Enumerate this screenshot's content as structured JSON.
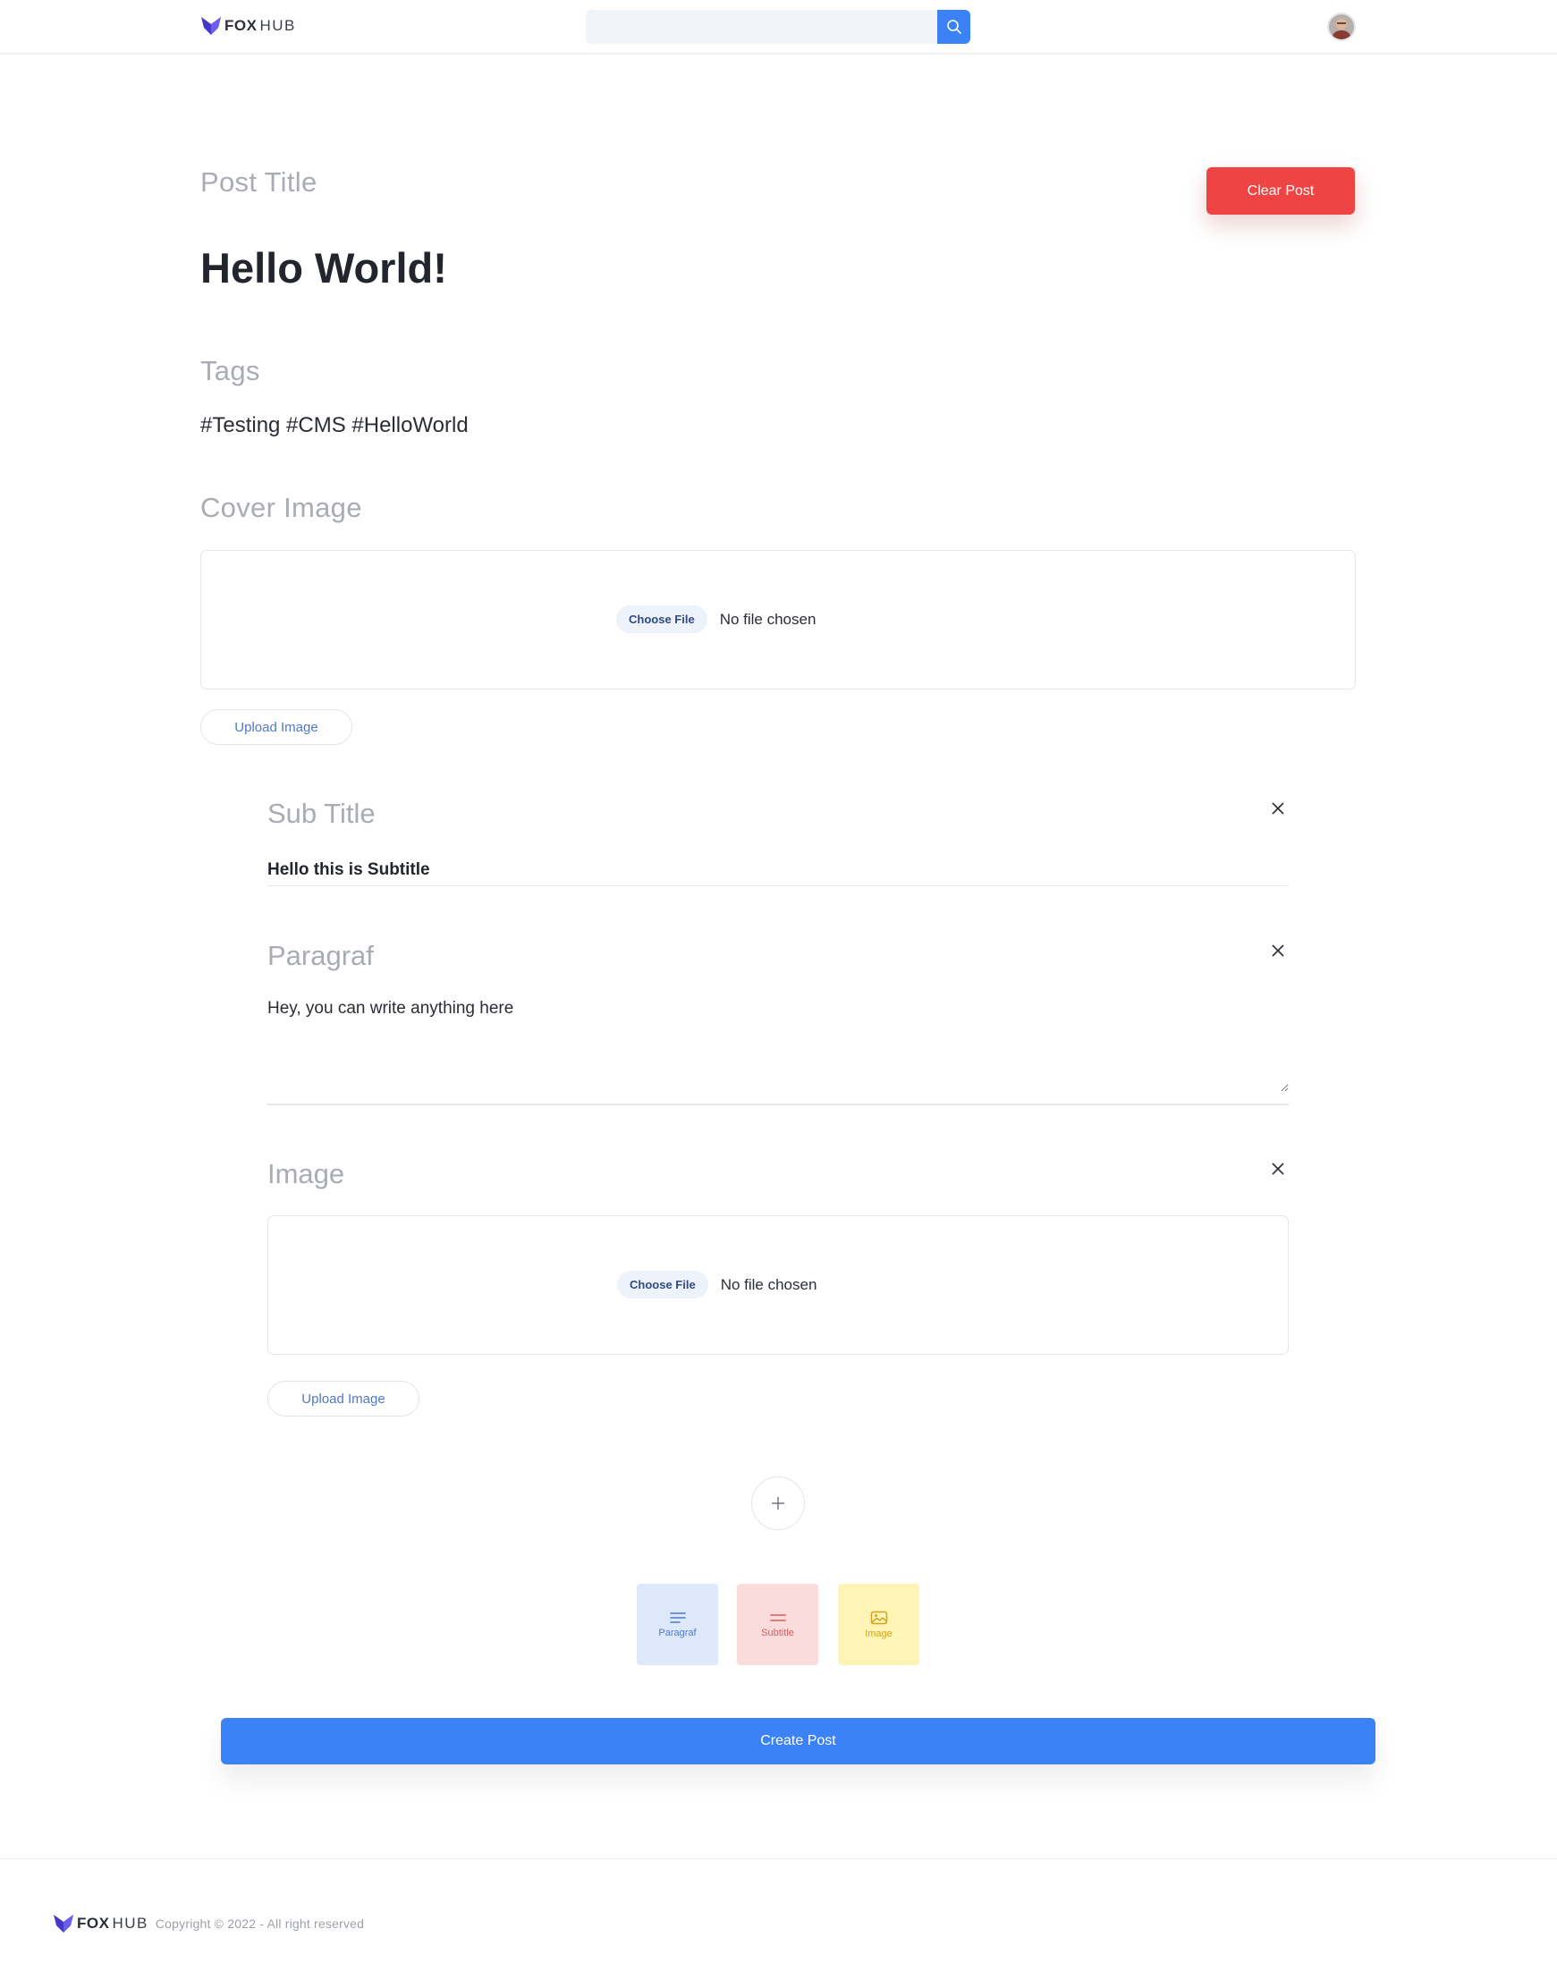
{
  "header": {
    "logo": {
      "fox": "FOX",
      "hub": "HUB"
    },
    "search": {
      "placeholder": "",
      "value": ""
    }
  },
  "form": {
    "post_title_label": "Post Title",
    "post_title_value": "Hello World!",
    "clear_button": "Clear Post",
    "tags_label": "Tags",
    "tags_value": "#Testing #CMS #HelloWorld",
    "cover_label": "Cover Image",
    "cover_file": {
      "choose_label": "Choose File",
      "status": "No file chosen"
    },
    "cover_upload_button": "Upload Image",
    "blocks": [
      {
        "type": "subtitle",
        "label": "Sub Title",
        "value": "Hello this is Subtitle"
      },
      {
        "type": "paragraf",
        "label": "Paragraf",
        "value": "Hey, you can write anything here"
      },
      {
        "type": "image",
        "label": "Image",
        "choose_label": "Choose File",
        "status": "No file chosen",
        "upload_button": "Upload Image"
      }
    ],
    "add_block_symbol": "+",
    "block_types": [
      {
        "label": "Paragraf",
        "icon": "paragraph-lines-icon",
        "color": "#4f79c9"
      },
      {
        "label": "Subtitle",
        "icon": "subtitle-lines-icon",
        "color": "#e0585b"
      },
      {
        "label": "Image",
        "icon": "image-icon",
        "color": "#d2a51d"
      }
    ],
    "create_button": "Create Post"
  },
  "footer": {
    "logo": {
      "fox": "FOX",
      "hub": "HUB"
    },
    "copyright": "Copyright © 2022 - All right reserved"
  },
  "colors": {
    "primary": "#3b82f6",
    "danger": "#ef4444",
    "brand_logo": "#4338ca"
  }
}
